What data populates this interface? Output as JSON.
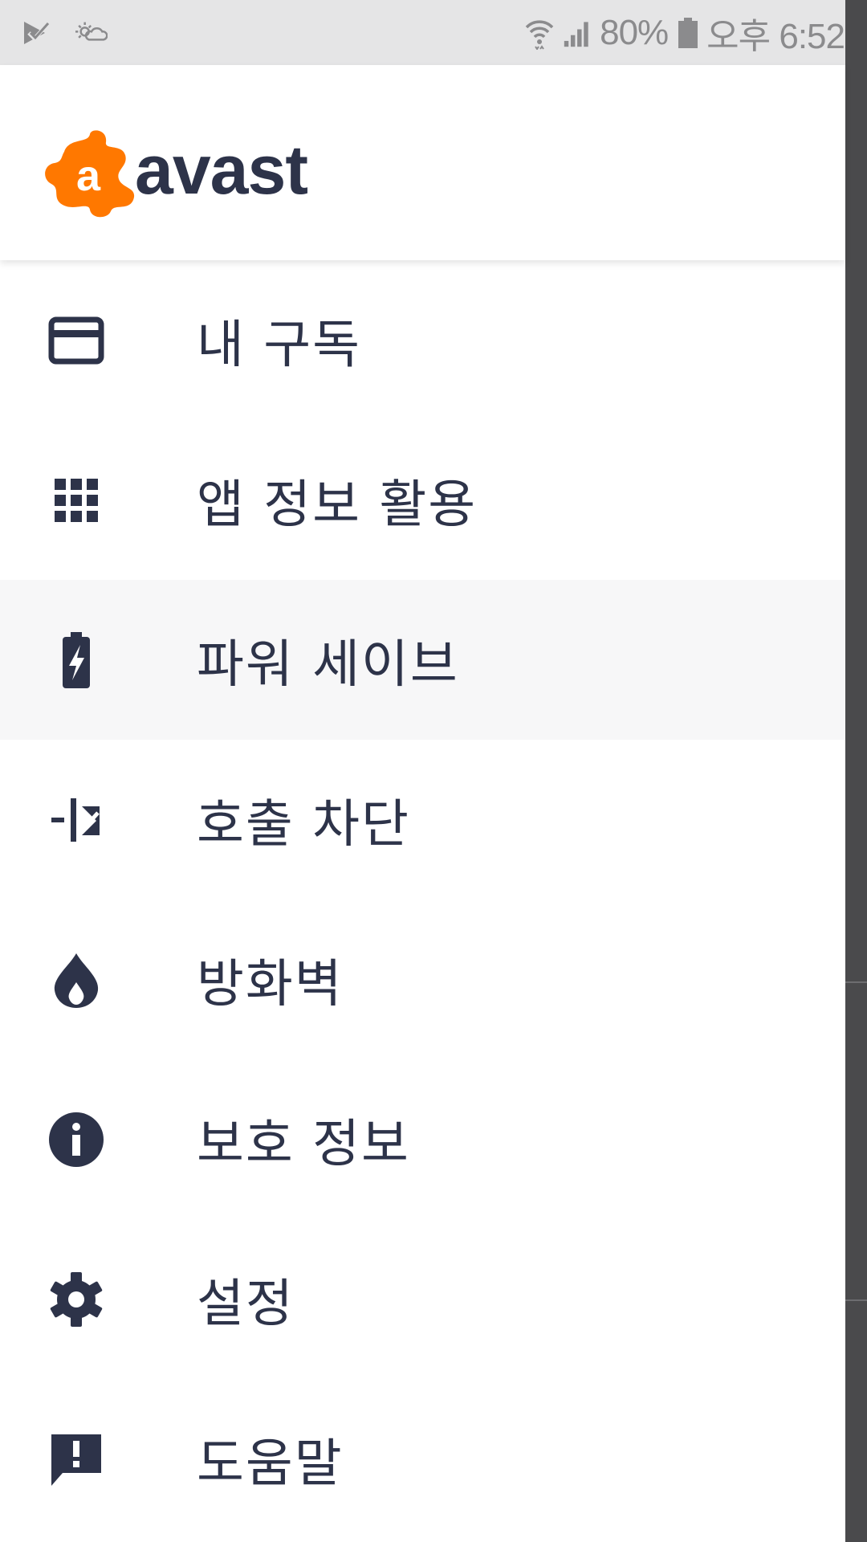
{
  "status_bar": {
    "battery_percent": "80%",
    "time": "오후 6:52",
    "icons": [
      "download-check-icon",
      "weather-icon",
      "wifi-icon",
      "signal-icon",
      "battery-icon"
    ]
  },
  "drawer": {
    "brand": "avast",
    "logo_letter": "a",
    "brand_color": "#ff7800",
    "text_color": "#2d3349",
    "items": [
      {
        "label": "내 구독",
        "icon": "credit-card-icon"
      },
      {
        "label": "앱 정보 활용",
        "icon": "app-grid-icon"
      },
      {
        "label": "파워 세이브",
        "icon": "battery-charging-icon"
      },
      {
        "label": "호출 차단",
        "icon": "call-block-icon"
      },
      {
        "label": "방화벽",
        "icon": "flame-icon"
      },
      {
        "label": "보호 정보",
        "icon": "info-icon"
      },
      {
        "label": "설정",
        "icon": "gear-icon"
      },
      {
        "label": "도움말",
        "icon": "feedback-icon"
      }
    ],
    "active_item": "파워 세이브"
  }
}
